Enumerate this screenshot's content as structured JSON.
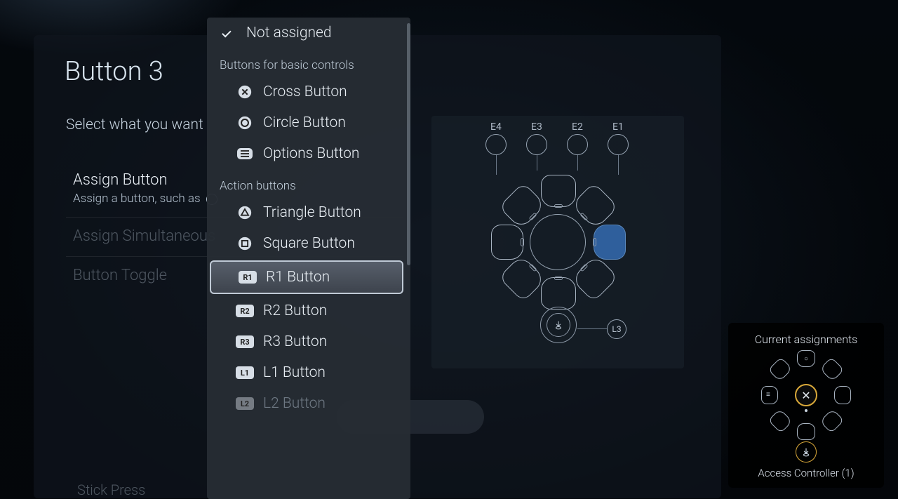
{
  "title": "Button 3",
  "subtitle": "Select what you want",
  "sidebar": {
    "items": [
      {
        "label": "Assign Button",
        "desc": "Assign a button, such as"
      },
      {
        "label": "Assign Simultaneous"
      },
      {
        "label": "Button Toggle"
      }
    ],
    "stick_press": "Stick Press"
  },
  "dropdown": {
    "not_assigned": "Not assigned",
    "section_basic": "Buttons for basic controls",
    "section_action": "Action buttons",
    "items": {
      "cross": "Cross Button",
      "circle": "Circle Button",
      "options": "Options Button",
      "triangle": "Triangle Button",
      "square": "Square Button",
      "r1": "R1 Button",
      "r2": "R2 Button",
      "r3": "R3 Button",
      "l1": "L1 Button",
      "l2": "L2 Button"
    },
    "badges": {
      "r1": "R1",
      "r2": "R2",
      "r3": "R3",
      "l1": "L1",
      "l2": "L2"
    },
    "selected": "r1"
  },
  "diagram": {
    "ext_ports": [
      "E4",
      "E3",
      "E2",
      "E1"
    ],
    "l3": "L3",
    "highlighted_petal_index": 2
  },
  "assignments": {
    "title": "Current assignments",
    "center_glyph": "✕",
    "top_glyph": "○",
    "left_glyph": "≡",
    "device_label": "Access Controller (1)"
  }
}
